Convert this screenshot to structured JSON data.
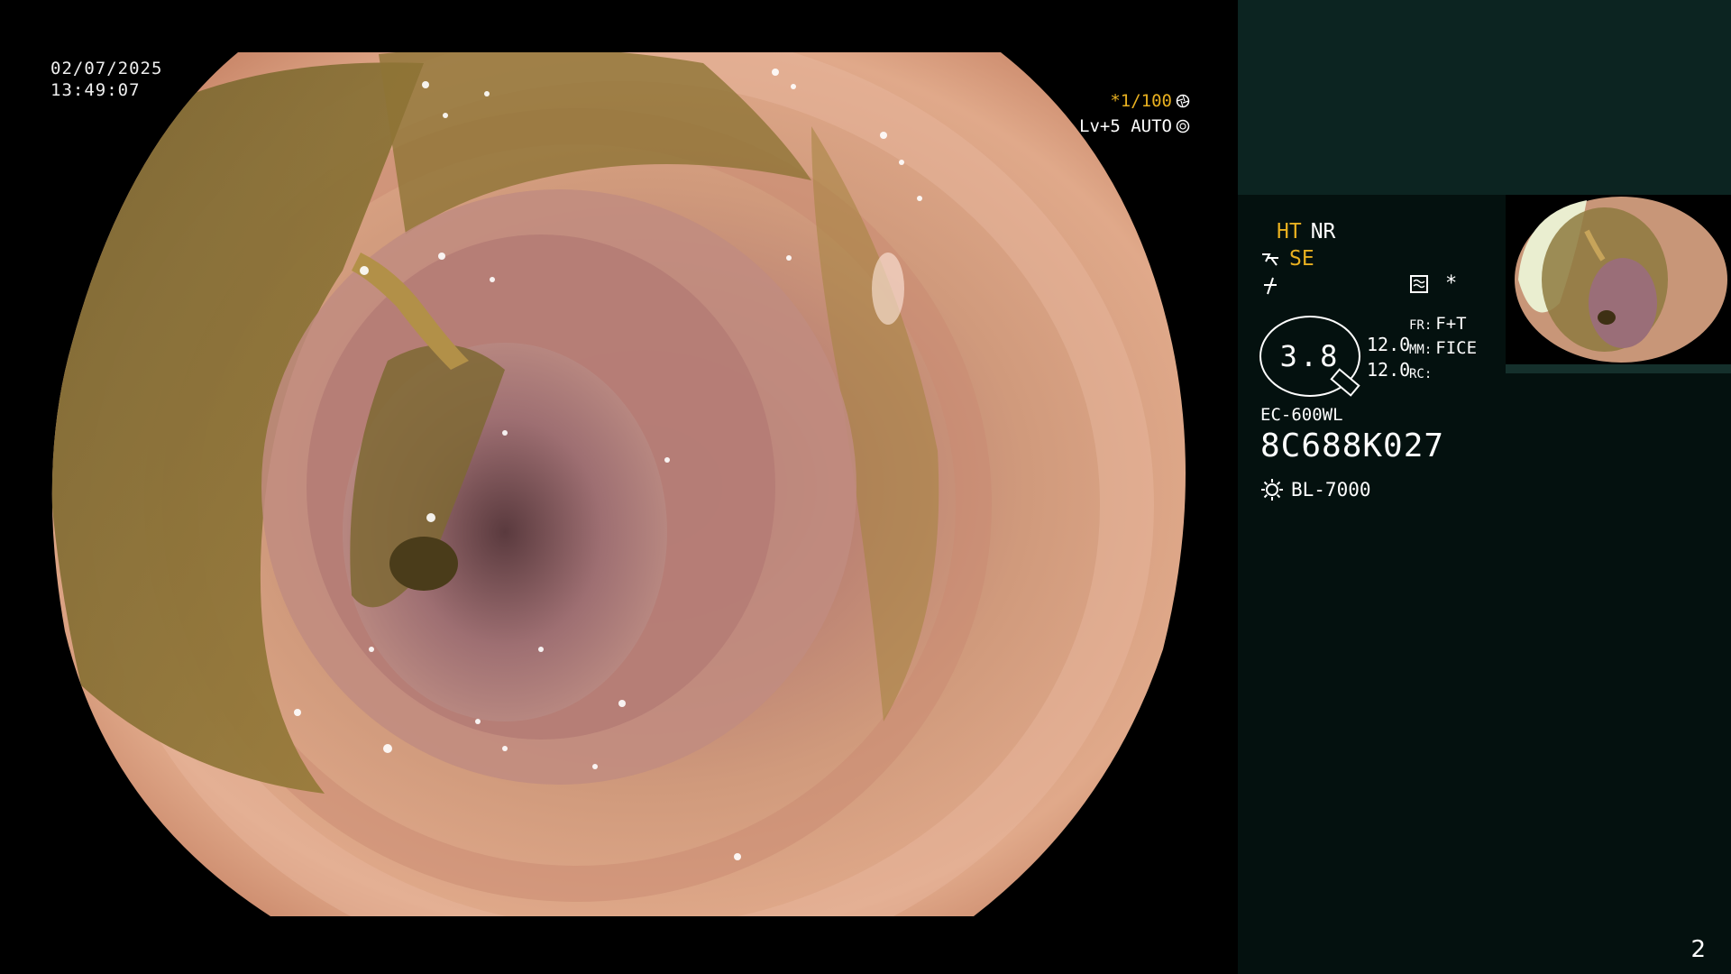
{
  "overlay": {
    "date": "02/07/2025",
    "time": "13:49:07",
    "shutter": "*1/100",
    "shutter_icon": "shutter-icon",
    "level": "Lv+5 AUTO",
    "level_icon": "auto-iris-icon"
  },
  "panel": {
    "mode_ht": "HT",
    "mode_nr": "NR",
    "mode_se": "SE",
    "icons": [
      "structure-enhance-icon",
      "color-enhance-icon",
      "waveform-icon",
      "asterisk-icon"
    ],
    "asterisk": "*",
    "zoom_value": "3.8",
    "values": [
      "12.0",
      "12.0"
    ],
    "settings": [
      {
        "key": "FR:",
        "value": "F+T"
      },
      {
        "key": "MM:",
        "value": "FICE"
      },
      {
        "key": "RC:",
        "value": ""
      }
    ],
    "scope_model": "EC-600WL",
    "scope_serial": "8C688K027",
    "light_source": "BL-7000",
    "light_icon": "sun-icon"
  },
  "page_number": "2",
  "colors": {
    "accent_orange": "#e8b020",
    "panel_bg": "#04110f",
    "panel_header": "#0c2421"
  }
}
